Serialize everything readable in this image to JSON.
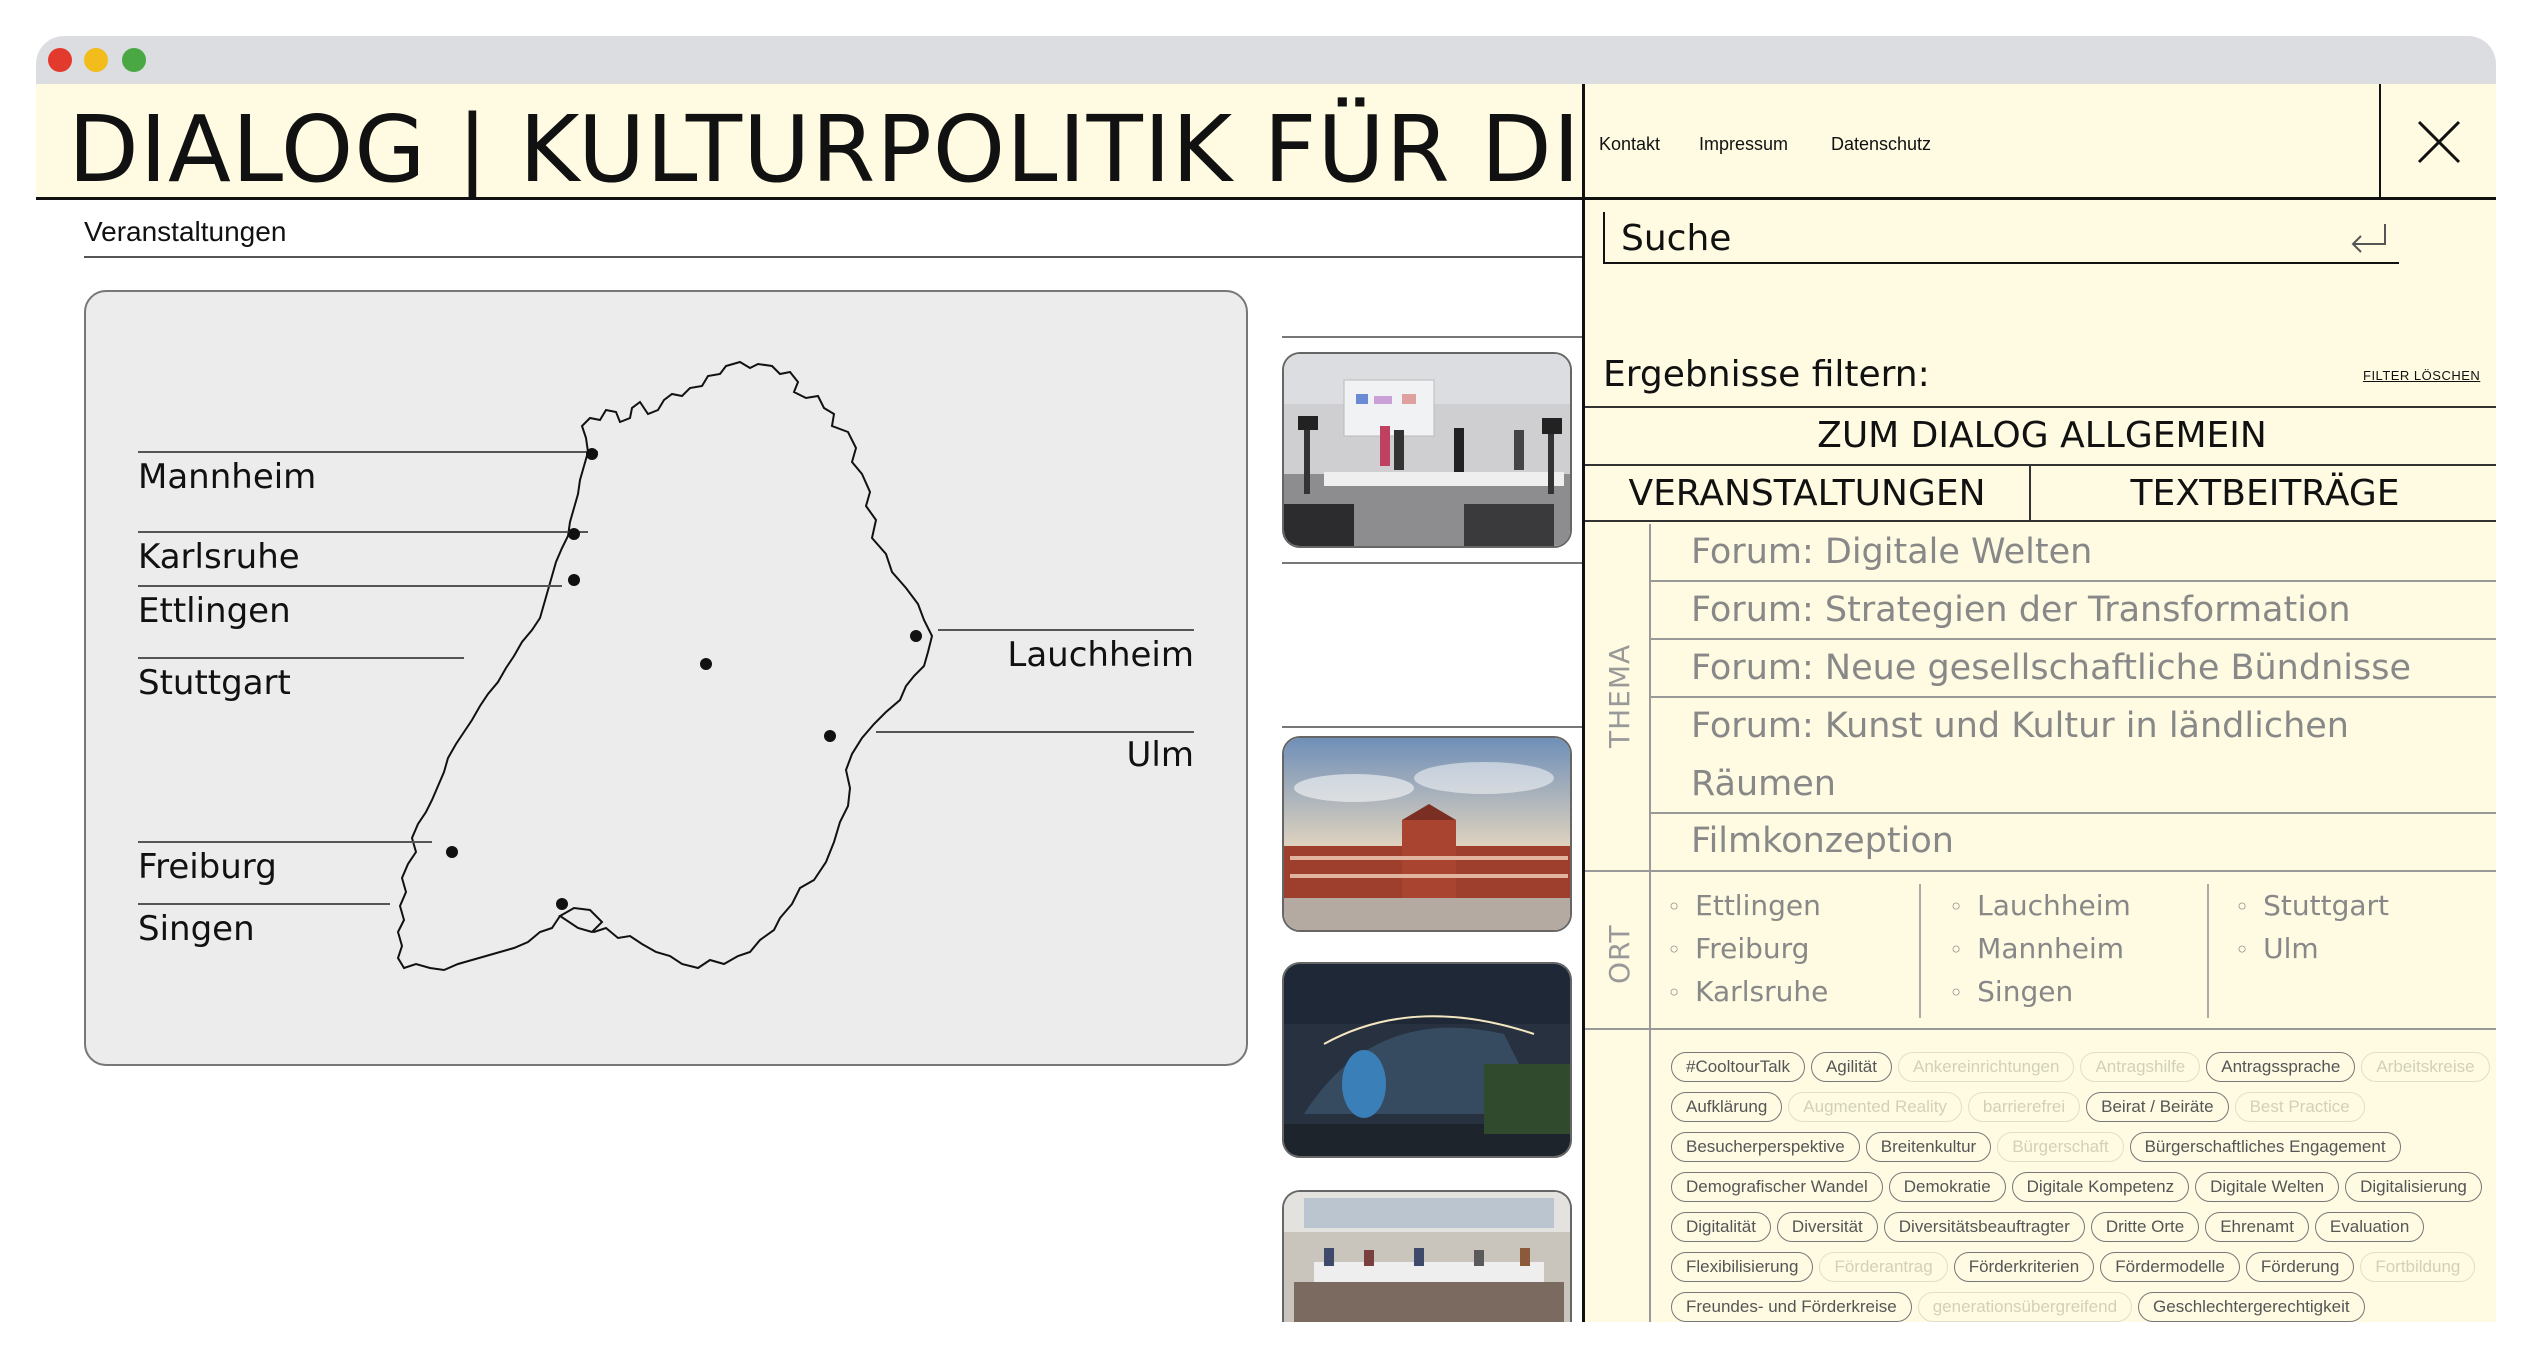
{
  "site": {
    "title": "DIALOG | KULTURPOLITIK FÜR DIE Z",
    "breadcrumb": "Veranstaltungen"
  },
  "map": {
    "cities": {
      "mannheim": "Mannheim",
      "karlsruhe": "Karlsruhe",
      "ettlingen": "Ettlingen",
      "stuttgart": "Stuttgart",
      "lauchheim": "Lauchheim",
      "ulm": "Ulm",
      "freiburg": "Freiburg",
      "singen": "Singen"
    }
  },
  "panel": {
    "links": [
      "Kontakt",
      "Impressum",
      "Datenschutz"
    ],
    "search_placeholder": "Suche",
    "filter_title": "Ergebnisse filtern:",
    "filter_clear": "FILTER LÖSCHEN",
    "allgemein": "ZUM DIALOG ALLGEMEIN",
    "veranstaltungen": "VERANSTALTUNGEN",
    "textbeitraege": "TEXTBEITRÄGE",
    "thema_label": "THEMA",
    "ort_label": "ORT",
    "themes": [
      "Forum: Digitale Welten",
      "Forum: Strategien der Transformation",
      "Forum: Neue gesellschaftliche Bündnisse",
      "Forum: Kunst und Kultur in ländlichen",
      "Räumen",
      "Filmkonzeption"
    ],
    "orte": {
      "col1": [
        "Ettlingen",
        "Freiburg",
        "Karlsruhe"
      ],
      "col2": [
        "Lauchheim",
        "Mannheim",
        "Singen"
      ],
      "col3": [
        "Stuttgart",
        "Ulm"
      ]
    },
    "tags": [
      {
        "label": "#CooltourTalk",
        "faint": false
      },
      {
        "label": "Agilität",
        "faint": false
      },
      {
        "label": "Ankereinrichtungen",
        "faint": true
      },
      {
        "label": "Antragshilfe",
        "faint": true
      },
      {
        "label": "Antragssprache",
        "faint": false
      },
      {
        "label": "Arbeitskreise",
        "faint": true
      },
      {
        "label": "Aufklärung",
        "faint": false
      },
      {
        "label": "Augmented Reality",
        "faint": true
      },
      {
        "label": "barrierefrei",
        "faint": true
      },
      {
        "label": "Beirat / Beiräte",
        "faint": false
      },
      {
        "label": "Best Practice",
        "faint": true
      },
      {
        "label": "Besucherperspektive",
        "faint": false
      },
      {
        "label": "Breitenkultur",
        "faint": false
      },
      {
        "label": "Bürgerschaft",
        "faint": true
      },
      {
        "label": "Bürgerschaftliches Engagement",
        "faint": false
      },
      {
        "label": "Demografischer Wandel",
        "faint": false
      },
      {
        "label": "Demokratie",
        "faint": false
      },
      {
        "label": "Digitale Kompetenz",
        "faint": false
      },
      {
        "label": "Digitale Welten",
        "faint": false
      },
      {
        "label": "Digitalisierung",
        "faint": false
      },
      {
        "label": "Digitalität",
        "faint": false
      },
      {
        "label": "Diversität",
        "faint": false
      },
      {
        "label": "Diversitätsbeauftragter",
        "faint": false
      },
      {
        "label": "Dritte Orte",
        "faint": false
      },
      {
        "label": "Ehrenamt",
        "faint": false
      },
      {
        "label": "Evaluation",
        "faint": false
      },
      {
        "label": "Flexibilisierung",
        "faint": false
      },
      {
        "label": "Förderantrag",
        "faint": true
      },
      {
        "label": "Förderkriterien",
        "faint": false
      },
      {
        "label": "Fördermodelle",
        "faint": false
      },
      {
        "label": "Förderung",
        "faint": false
      },
      {
        "label": "Fortbildung",
        "faint": true
      },
      {
        "label": "Freundes- und Förderkreise",
        "faint": false
      },
      {
        "label": "generationsübergreifend",
        "faint": true
      },
      {
        "label": "Geschlechtergerechtigkeit",
        "faint": false
      }
    ]
  }
}
